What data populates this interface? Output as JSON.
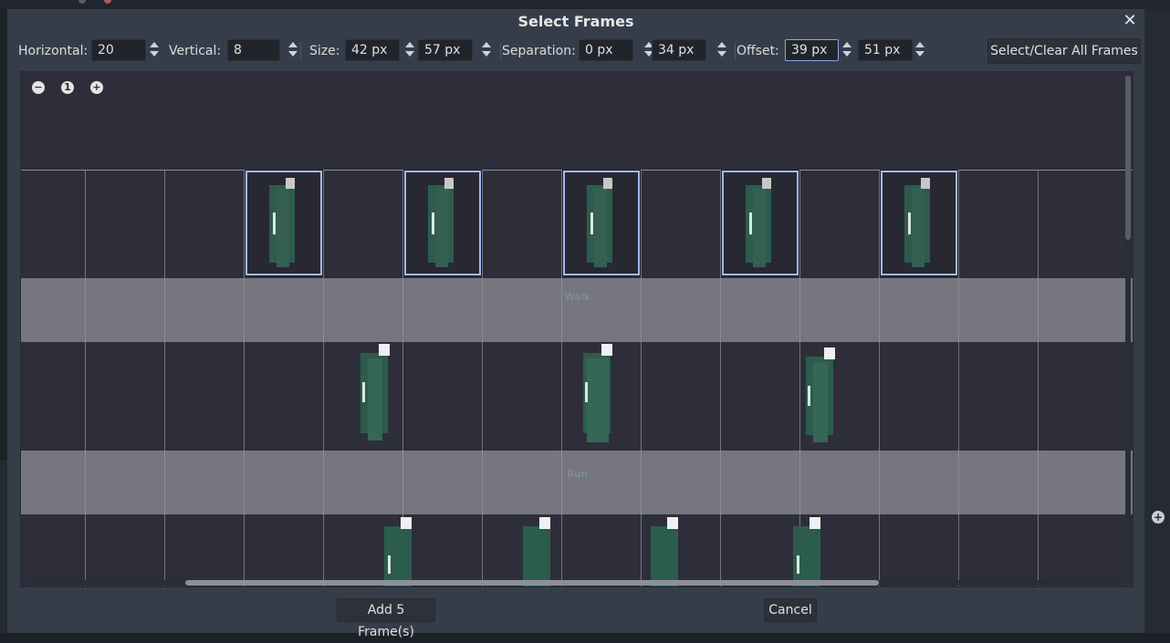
{
  "dialog": {
    "title": "Select Frames",
    "close_icon": "close-icon"
  },
  "toolbar": {
    "horizontal_label": "Horizontal:",
    "horizontal_value": "20",
    "vertical_label": "Vertical:",
    "vertical_value": "8",
    "size_label": "Size:",
    "size_x": "42 px",
    "size_y": "57 px",
    "separation_label": "Separation:",
    "separation_x": "0 px",
    "separation_y": "34 px",
    "offset_label": "Offset:",
    "offset_x": "39 px",
    "offset_y": "51 px",
    "select_clear_label": "Select/Clear All Frames"
  },
  "canvas": {
    "zoom_out_icon": "minus-circle-icon",
    "zoom_reset_label": "1",
    "zoom_in_icon": "plus-circle-icon",
    "bands": [
      {
        "label": "Walk"
      },
      {
        "label": "Run"
      }
    ],
    "selected_frames_count": 5
  },
  "footer": {
    "add_button_label": "Add 5 Frame(s)",
    "cancel_button_label": "Cancel"
  },
  "colors": {
    "dialog_bg": "#363d4a",
    "canvas_bg": "#2d2e39",
    "selection_border": "#a6b8f2",
    "sprite_green": "#2c5c4e"
  }
}
